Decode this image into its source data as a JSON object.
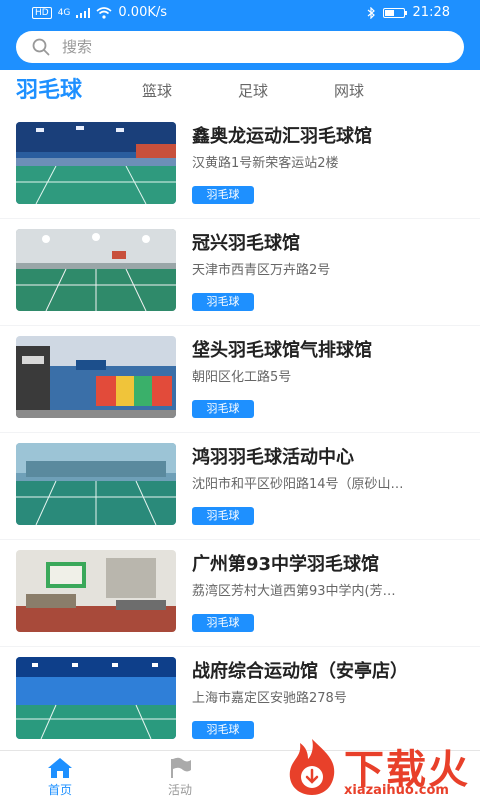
{
  "status_bar": {
    "network_badge": "HD",
    "signal_label": "4G",
    "speed": "0.00K/s",
    "time": "21:28",
    "battery_level": 0.55
  },
  "search": {
    "placeholder": "搜索",
    "value": ""
  },
  "tabs": [
    {
      "label": "羽毛球",
      "active": true
    },
    {
      "label": "篮球",
      "active": false
    },
    {
      "label": "足球",
      "active": false
    },
    {
      "label": "网球",
      "active": false
    }
  ],
  "venues": [
    {
      "name": "鑫奥龙运动汇羽毛球馆",
      "address": "汉黄路1号新荣客运站2楼",
      "tag": "羽毛球"
    },
    {
      "name": "冠兴羽毛球馆",
      "address": "天津市西青区万卉路2号",
      "tag": "羽毛球"
    },
    {
      "name": "垡头羽毛球馆气排球馆",
      "address": "朝阳区化工路5号",
      "tag": "羽毛球"
    },
    {
      "name": "鸿羽羽毛球活动中心",
      "address": "沈阳市和平区砂阳路14号（原砂山…",
      "tag": "羽毛球"
    },
    {
      "name": "广州第93中学羽毛球馆",
      "address": "荔湾区芳村大道西第93中学内(芳…",
      "tag": "羽毛球"
    },
    {
      "name": "战府综合运动馆（安亭店）",
      "address": "上海市嘉定区安驰路278号",
      "tag": "羽毛球"
    }
  ],
  "bottom_nav": [
    {
      "label": "首页",
      "icon": "home-icon",
      "active": true
    },
    {
      "label": "活动",
      "icon": "flag-icon",
      "active": false
    }
  ],
  "watermark": {
    "brand": "下载火",
    "url": "xiazaihuo.com"
  },
  "colors": {
    "accent": "#1e90ff",
    "watermark": "#e8402a"
  }
}
